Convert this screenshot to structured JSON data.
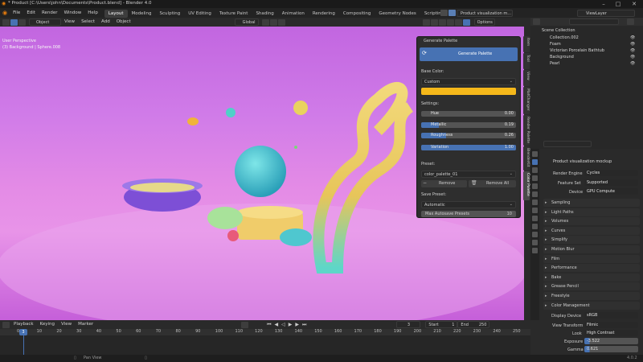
{
  "window": {
    "title": "* Product [C:\\Users\\john\\Documents\\Product.blend] - Blender 4.0"
  },
  "menus": [
    "File",
    "Edit",
    "Render",
    "Window",
    "Help"
  ],
  "workspaces": [
    "Layout",
    "Modeling",
    "Sculpting",
    "UV Editing",
    "Texture Paint",
    "Shading",
    "Animation",
    "Rendering",
    "Compositing",
    "Geometry Nodes",
    "Scripting"
  ],
  "active_workspace": "Layout",
  "scene_field": "Product visualization m...",
  "viewlayer_field": "ViewLayer",
  "viewport": {
    "mode": "Object Mode",
    "menus": [
      "View",
      "Select",
      "Add",
      "Object"
    ],
    "orientation": "Global",
    "options": "Options",
    "overlay_line1": "User Perspective",
    "overlay_line2": "(3) Background | Sphere.008"
  },
  "palette": {
    "title": "Generate Palette",
    "button": "Generate Palette",
    "base_color_label": "Base Color:",
    "base_color_value": "Custom",
    "swatch": "#f5b81a",
    "settings_label": "Settings:",
    "sliders": [
      {
        "label": "Hue",
        "value": "0.00",
        "fill": 0.0
      },
      {
        "label": "Metallic",
        "value": "0.19",
        "fill": 0.19
      },
      {
        "label": "Roughness",
        "value": "0.26",
        "fill": 0.26
      },
      {
        "label": "Variation",
        "value": "1.00",
        "fill": 1.0
      }
    ],
    "preset_label": "Preset:",
    "preset_value": "color_palette_01",
    "remove": "Remove",
    "remove_all": "Remove All",
    "save_preset_label": "Save Preset:",
    "save_value": "Automatic",
    "max_autosave_label": "Max Autosave Presets",
    "max_autosave_value": "10"
  },
  "sidebar_tabs": [
    "Item",
    "Tool",
    "View",
    "MatChanger",
    "Render Palette",
    "BlenderKit",
    "Color Palette"
  ],
  "outliner": {
    "root": "Scene Collection",
    "items": [
      "Collection.002",
      "Foam",
      "Victorian Porcelain Bathtub",
      "Background",
      "Pearl"
    ]
  },
  "properties": {
    "object": "Product visualization mockup",
    "render_engine_label": "Render Engine",
    "render_engine": "Cycles",
    "feature_set_label": "Feature Set",
    "feature_set": "Supported",
    "device_label": "Device",
    "device": "GPU Compute",
    "sections": [
      "Sampling",
      "Light Paths",
      "Volumes",
      "Curves",
      "Simplify",
      "Motion Blur",
      "Film",
      "Performance",
      "Bake",
      "Grease Pencil",
      "Freestyle",
      "Color Management"
    ],
    "display_device_label": "Display Device",
    "display_device": "sRGB",
    "view_transform_label": "View Transform",
    "view_transform": "Filmic",
    "look_label": "Look",
    "look": "High Contrast",
    "exposure_label": "Exposure",
    "exposure": "-3.522",
    "gamma_label": "Gamma",
    "gamma": "0.621"
  },
  "timeline": {
    "menus": [
      "Playback",
      "Keying",
      "View",
      "Marker"
    ],
    "current_frame": "3",
    "start_label": "Start",
    "start": "1",
    "end_label": "End",
    "end": "250",
    "ticks": [
      "0",
      "10",
      "20",
      "30",
      "40",
      "50",
      "60",
      "70",
      "80",
      "90",
      "100",
      "110",
      "120",
      "130",
      "140",
      "150",
      "160",
      "170",
      "180",
      "190",
      "200",
      "210",
      "220",
      "230",
      "240",
      "250"
    ],
    "playhead": "3"
  },
  "status": {
    "pan": "Pan View",
    "version": "4.0.2"
  }
}
